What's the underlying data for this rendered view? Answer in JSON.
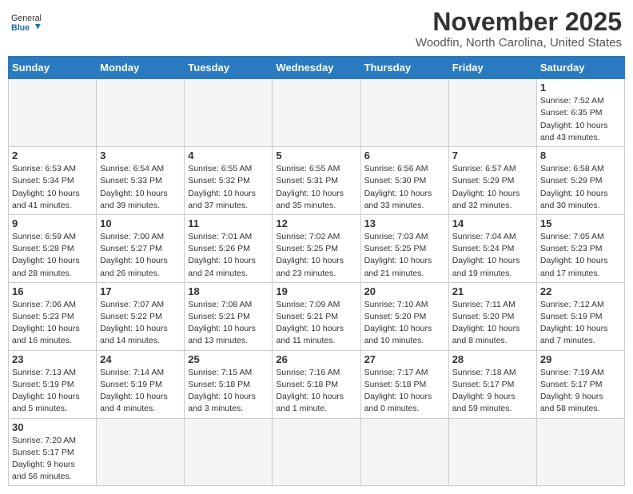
{
  "header": {
    "logo_general": "General",
    "logo_blue": "Blue",
    "month_title": "November 2025",
    "location": "Woodfin, North Carolina, United States"
  },
  "weekdays": [
    "Sunday",
    "Monday",
    "Tuesday",
    "Wednesday",
    "Thursday",
    "Friday",
    "Saturday"
  ],
  "weeks": [
    [
      {
        "day": "",
        "info": ""
      },
      {
        "day": "",
        "info": ""
      },
      {
        "day": "",
        "info": ""
      },
      {
        "day": "",
        "info": ""
      },
      {
        "day": "",
        "info": ""
      },
      {
        "day": "",
        "info": ""
      },
      {
        "day": "1",
        "info": "Sunrise: 7:52 AM\nSunset: 6:35 PM\nDaylight: 10 hours\nand 43 minutes."
      }
    ],
    [
      {
        "day": "2",
        "info": "Sunrise: 6:53 AM\nSunset: 5:34 PM\nDaylight: 10 hours\nand 41 minutes."
      },
      {
        "day": "3",
        "info": "Sunrise: 6:54 AM\nSunset: 5:33 PM\nDaylight: 10 hours\nand 39 minutes."
      },
      {
        "day": "4",
        "info": "Sunrise: 6:55 AM\nSunset: 5:32 PM\nDaylight: 10 hours\nand 37 minutes."
      },
      {
        "day": "5",
        "info": "Sunrise: 6:55 AM\nSunset: 5:31 PM\nDaylight: 10 hours\nand 35 minutes."
      },
      {
        "day": "6",
        "info": "Sunrise: 6:56 AM\nSunset: 5:30 PM\nDaylight: 10 hours\nand 33 minutes."
      },
      {
        "day": "7",
        "info": "Sunrise: 6:57 AM\nSunset: 5:29 PM\nDaylight: 10 hours\nand 32 minutes."
      },
      {
        "day": "8",
        "info": "Sunrise: 6:58 AM\nSunset: 5:29 PM\nDaylight: 10 hours\nand 30 minutes."
      }
    ],
    [
      {
        "day": "9",
        "info": "Sunrise: 6:59 AM\nSunset: 5:28 PM\nDaylight: 10 hours\nand 28 minutes."
      },
      {
        "day": "10",
        "info": "Sunrise: 7:00 AM\nSunset: 5:27 PM\nDaylight: 10 hours\nand 26 minutes."
      },
      {
        "day": "11",
        "info": "Sunrise: 7:01 AM\nSunset: 5:26 PM\nDaylight: 10 hours\nand 24 minutes."
      },
      {
        "day": "12",
        "info": "Sunrise: 7:02 AM\nSunset: 5:25 PM\nDaylight: 10 hours\nand 23 minutes."
      },
      {
        "day": "13",
        "info": "Sunrise: 7:03 AM\nSunset: 5:25 PM\nDaylight: 10 hours\nand 21 minutes."
      },
      {
        "day": "14",
        "info": "Sunrise: 7:04 AM\nSunset: 5:24 PM\nDaylight: 10 hours\nand 19 minutes."
      },
      {
        "day": "15",
        "info": "Sunrise: 7:05 AM\nSunset: 5:23 PM\nDaylight: 10 hours\nand 17 minutes."
      }
    ],
    [
      {
        "day": "16",
        "info": "Sunrise: 7:06 AM\nSunset: 5:23 PM\nDaylight: 10 hours\nand 16 minutes."
      },
      {
        "day": "17",
        "info": "Sunrise: 7:07 AM\nSunset: 5:22 PM\nDaylight: 10 hours\nand 14 minutes."
      },
      {
        "day": "18",
        "info": "Sunrise: 7:08 AM\nSunset: 5:21 PM\nDaylight: 10 hours\nand 13 minutes."
      },
      {
        "day": "19",
        "info": "Sunrise: 7:09 AM\nSunset: 5:21 PM\nDaylight: 10 hours\nand 11 minutes."
      },
      {
        "day": "20",
        "info": "Sunrise: 7:10 AM\nSunset: 5:20 PM\nDaylight: 10 hours\nand 10 minutes."
      },
      {
        "day": "21",
        "info": "Sunrise: 7:11 AM\nSunset: 5:20 PM\nDaylight: 10 hours\nand 8 minutes."
      },
      {
        "day": "22",
        "info": "Sunrise: 7:12 AM\nSunset: 5:19 PM\nDaylight: 10 hours\nand 7 minutes."
      }
    ],
    [
      {
        "day": "23",
        "info": "Sunrise: 7:13 AM\nSunset: 5:19 PM\nDaylight: 10 hours\nand 5 minutes."
      },
      {
        "day": "24",
        "info": "Sunrise: 7:14 AM\nSunset: 5:19 PM\nDaylight: 10 hours\nand 4 minutes."
      },
      {
        "day": "25",
        "info": "Sunrise: 7:15 AM\nSunset: 5:18 PM\nDaylight: 10 hours\nand 3 minutes."
      },
      {
        "day": "26",
        "info": "Sunrise: 7:16 AM\nSunset: 5:18 PM\nDaylight: 10 hours\nand 1 minute."
      },
      {
        "day": "27",
        "info": "Sunrise: 7:17 AM\nSunset: 5:18 PM\nDaylight: 10 hours\nand 0 minutes."
      },
      {
        "day": "28",
        "info": "Sunrise: 7:18 AM\nSunset: 5:17 PM\nDaylight: 9 hours\nand 59 minutes."
      },
      {
        "day": "29",
        "info": "Sunrise: 7:19 AM\nSunset: 5:17 PM\nDaylight: 9 hours\nand 58 minutes."
      }
    ],
    [
      {
        "day": "30",
        "info": "Sunrise: 7:20 AM\nSunset: 5:17 PM\nDaylight: 9 hours\nand 56 minutes."
      },
      {
        "day": "",
        "info": ""
      },
      {
        "day": "",
        "info": ""
      },
      {
        "day": "",
        "info": ""
      },
      {
        "day": "",
        "info": ""
      },
      {
        "day": "",
        "info": ""
      },
      {
        "day": "",
        "info": ""
      }
    ]
  ]
}
